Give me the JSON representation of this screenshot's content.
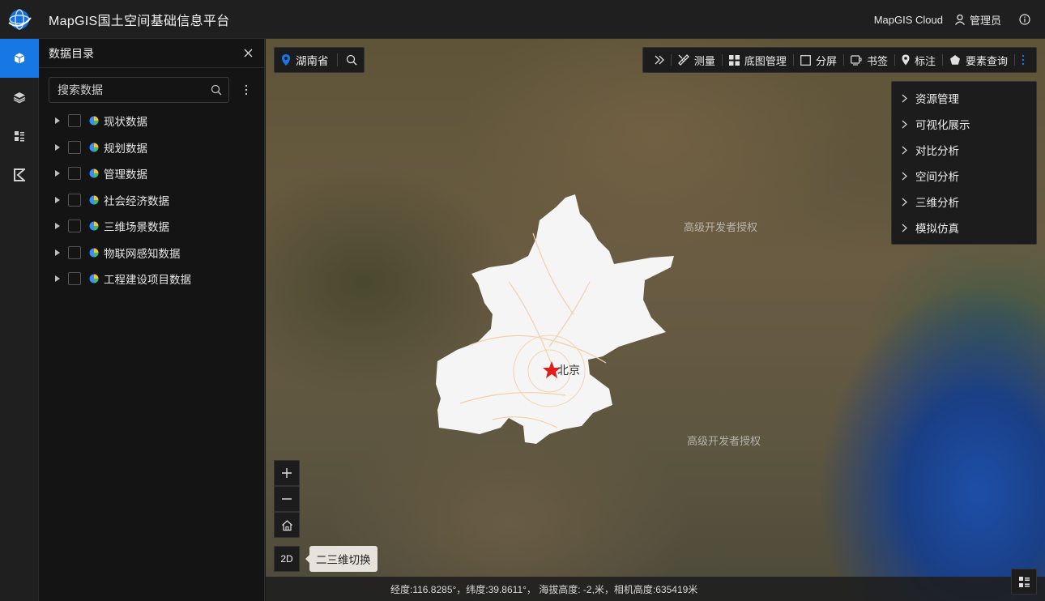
{
  "app": {
    "title": "MapGIS国土空间基础信息平台",
    "cloud_label": "MapGIS Cloud",
    "user_label": "管理员"
  },
  "panel": {
    "title": "数据目录",
    "search_placeholder": "搜索数据",
    "items": [
      {
        "label": "现状数据"
      },
      {
        "label": "规划数据"
      },
      {
        "label": "管理数据"
      },
      {
        "label": "社会经济数据"
      },
      {
        "label": "三维场景数据"
      },
      {
        "label": "物联网感知数据"
      },
      {
        "label": "工程建设项目数据"
      }
    ]
  },
  "map": {
    "location": "湖南省",
    "city_label": "北京",
    "watermark": "高级开发者授权",
    "toolbar": {
      "measure": "测量",
      "basemap": "底图管理",
      "split": "分屏",
      "bookmark": "书签",
      "mark": "标注",
      "query": "要素查询"
    },
    "menu": [
      "资源管理",
      "可视化展示",
      "对比分析",
      "空间分析",
      "三维分析",
      "模拟仿真"
    ],
    "mode_button": "2D",
    "mode_tooltip": "二三维切换",
    "status": "经度:116.8285°，纬度:39.8611°， 海拔高度: -2,米，相机高度:635419米"
  },
  "colors": {
    "accent": "#1677e5",
    "panel_bg": "#141414",
    "map_water": "#1d4fa8"
  }
}
